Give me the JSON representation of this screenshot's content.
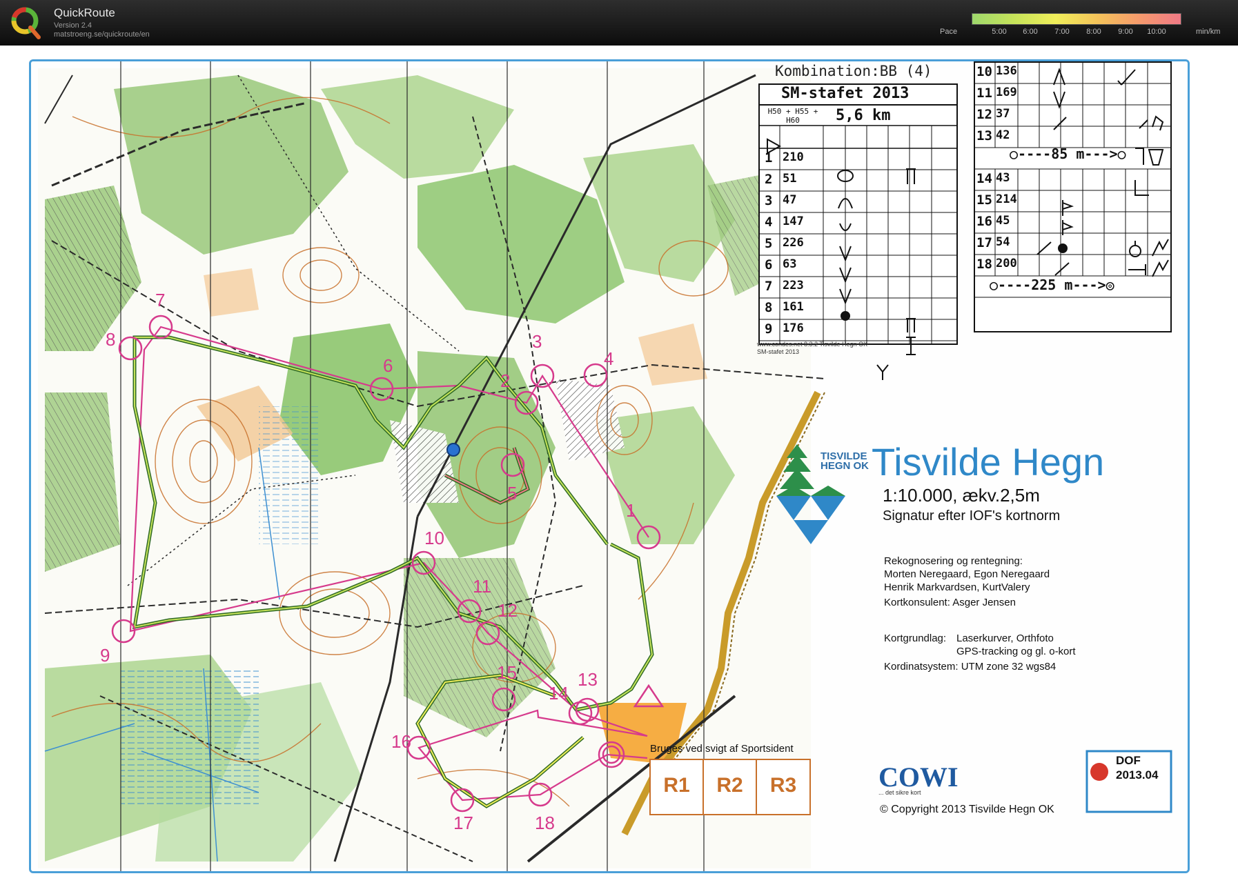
{
  "app": {
    "title": "QuickRoute",
    "version": "Version 2.4",
    "url": "matstroeng.se/quickroute/en"
  },
  "pace_legend": {
    "label": "Pace",
    "ticks": [
      "5:00",
      "6:00",
      "7:00",
      "8:00",
      "9:00",
      "10:00"
    ],
    "unit": "min/km",
    "gradient": [
      "#9fd86c",
      "#c6e35a",
      "#f0ee5a",
      "#f4c35a",
      "#f59a6c",
      "#f07a86"
    ]
  },
  "map": {
    "event_title": "Kombination:BB (4)",
    "event_name": "SM-stafet 2013",
    "class_label": "H50 + H55 + H60",
    "length": "5,6 km",
    "control_rows_left": [
      {
        "n": "1",
        "code": "210"
      },
      {
        "n": "2",
        "code": "51"
      },
      {
        "n": "3",
        "code": "47"
      },
      {
        "n": "4",
        "code": "147"
      },
      {
        "n": "5",
        "code": "226"
      },
      {
        "n": "6",
        "code": "63"
      },
      {
        "n": "7",
        "code": "223"
      },
      {
        "n": "8",
        "code": "161"
      },
      {
        "n": "9",
        "code": "176"
      }
    ],
    "control_rows_right_a": [
      {
        "n": "10",
        "code": "136"
      },
      {
        "n": "11",
        "code": "169"
      },
      {
        "n": "12",
        "code": "37"
      },
      {
        "n": "13",
        "code": "42"
      }
    ],
    "marked_route_1": "85 m",
    "control_rows_right_b": [
      {
        "n": "14",
        "code": "43"
      },
      {
        "n": "15",
        "code": "214"
      },
      {
        "n": "16",
        "code": "45"
      },
      {
        "n": "17",
        "code": "54"
      },
      {
        "n": "18",
        "code": "200"
      }
    ],
    "marked_route_2": "225 m",
    "software_credit_1": "www.condes.net 8.3.2 Tisvilde Hegn OK",
    "software_credit_2": "SM-stafet 2013",
    "club_line1": "TISVILDE",
    "club_line2": "HEGN OK",
    "map_title": "Tisvilde Hegn",
    "scale": "1:10.000,  ækv.2,5m",
    "norm": "Signatur efter IOF's kortnorm",
    "credits_heading": "Rekognosering og rentegning:",
    "credits_1": "Morten Neregaard, Egon Neregaard",
    "credits_2": "Henrik Markvardsen, KurtValery",
    "consultant": "Kortkonsulent: Asger Jensen",
    "basis_label": "Kortgrundlag:",
    "basis_1": "Laserkurver, Orthfoto",
    "basis_2": "GPS-tracking og gl. o-kort",
    "coord_system": "Kordinatsystem: UTM zone 32 wgs84",
    "backup_heading": "Bruges ved svigt af Sportsident",
    "backup_boxes": [
      "R1",
      "R2",
      "R3"
    ],
    "cowi": "COWI",
    "cowi_tag": "... det sikre kort",
    "copyright": "Copyright 2013 Tisvilde Hegn OK",
    "dof_1": "DOF",
    "dof_2": "2013.04",
    "course_control_numbers": [
      "1",
      "2",
      "3",
      "4",
      "5",
      "6",
      "7",
      "8",
      "9",
      "10",
      "11",
      "12",
      "13",
      "14",
      "15",
      "16",
      "17",
      "18"
    ],
    "colors": {
      "course": "#d63a8c",
      "forest": "#7cb55a",
      "contour": "#c8702a",
      "water": "#3d8fd1",
      "track": "#3f8a35",
      "border": "#4a9fd8"
    }
  }
}
